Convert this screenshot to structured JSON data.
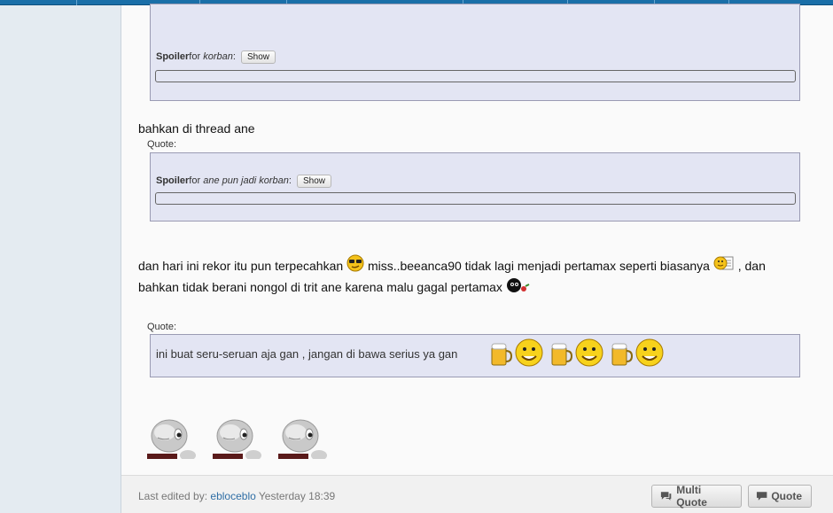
{
  "post": {
    "first_spoiler": {
      "label": "Spoiler",
      "for_text": "for",
      "title": "korban",
      "button": "Show"
    },
    "line1": "bahkan di thread ane",
    "quote_label_1": "Quote:",
    "second_spoiler": {
      "label": "Spoiler",
      "for_text": "for",
      "title": "ane pun jadi korban",
      "button": "Show"
    },
    "line2a": "dan hari ini rekor itu pun terpecahkan",
    "line2b": "miss..beeanca90 tidak lagi menjadi pertamax seperti biasanya",
    "line2c": ", dan",
    "line3": "bahkan tidak berani nongol di trit ane karena malu gagal pertamax",
    "quote_label_2": "Quote:",
    "quote2_text": "ini buat seru-seruan aja gan , jangan di bawa serius ya gan"
  },
  "footer": {
    "edited_prefix": "Last edited by:",
    "edited_user": "ebloceblo",
    "edited_time": "Yesterday 18:39",
    "multi_quote_label": "Multi Quote",
    "quote_label": "Quote"
  },
  "icons": [
    "cool-smiley-icon",
    "writing-smiley-icon",
    "bomb-icon",
    "beer-smiley-icon",
    "mascot-avatar-icon",
    "speech-bubble-icon"
  ]
}
